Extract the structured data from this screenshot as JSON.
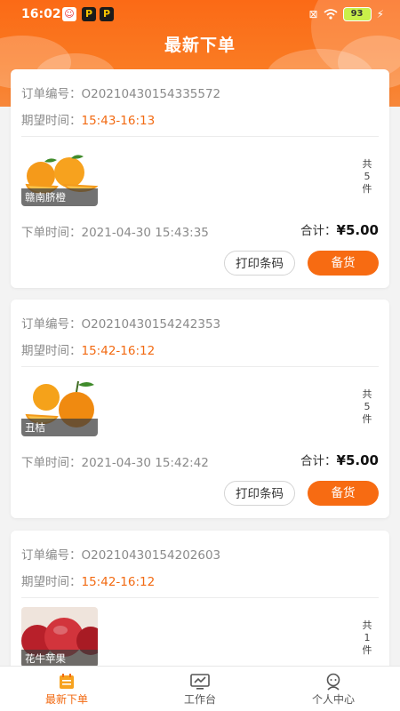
{
  "status_bar": {
    "time": "16:02",
    "battery": "93"
  },
  "header": {
    "title": "最新下单"
  },
  "orders": [
    {
      "order_label": "订单编号：",
      "order_no": "O20210430154335572",
      "expect_label": "期望时间：",
      "expect_time": "15:43-16:13",
      "product_name": "赣南脐橙",
      "qty_prefix": "共",
      "qty": "5",
      "qty_suffix": "件",
      "order_time_label": "下单时间：",
      "order_time": "2021-04-30 15:43:35",
      "total_label": "合计：",
      "total_amount": "¥5.00",
      "print_label": "打印条码",
      "stock_label": "备货"
    },
    {
      "order_label": "订单编号：",
      "order_no": "O20210430154242353",
      "expect_label": "期望时间：",
      "expect_time": "15:42-16:12",
      "product_name": "丑桔",
      "qty_prefix": "共",
      "qty": "5",
      "qty_suffix": "件",
      "order_time_label": "下单时间：",
      "order_time": "2021-04-30 15:42:42",
      "total_label": "合计：",
      "total_amount": "¥5.00",
      "print_label": "打印条码",
      "stock_label": "备货"
    },
    {
      "order_label": "订单编号：",
      "order_no": "O20210430154202603",
      "expect_label": "期望时间：",
      "expect_time": "15:42-16:12",
      "product_name": "花牛苹果",
      "qty_prefix": "共",
      "qty": "1",
      "qty_suffix": "件"
    }
  ],
  "tabbar": {
    "items": [
      {
        "label": "最新下单",
        "icon": "calendar-list-icon",
        "active": true
      },
      {
        "label": "工作台",
        "icon": "monitor-icon",
        "active": false
      },
      {
        "label": "个人中心",
        "icon": "person-icon",
        "active": false
      }
    ]
  },
  "colors": {
    "accent": "#f76b12",
    "header": "#fb6a16",
    "text_muted": "#8a8a8a"
  }
}
